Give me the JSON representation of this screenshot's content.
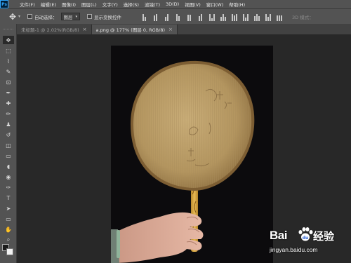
{
  "menubar": {
    "logo": "Ps",
    "items": [
      "文件(F)",
      "编辑(E)",
      "图像(I)",
      "图层(L)",
      "文字(Y)",
      "选择(S)",
      "滤镜(T)",
      "3D(D)",
      "视图(V)",
      "窗口(W)",
      "帮助(H)"
    ]
  },
  "options": {
    "auto_select_label": "自动选择：",
    "auto_select_value": "图层",
    "show_transform_label": "显示变换控件",
    "mode_3d_label": "3D 模式："
  },
  "tabs": [
    {
      "label": "未标题-1 @ 2.02%(RGB/8)",
      "active": false
    },
    {
      "label": "a.png @ 177% (图层 0, RGB/8)",
      "active": true
    }
  ],
  "icons": {
    "move": "✥",
    "marquee": "⬚",
    "lasso": "⌇",
    "quick_select": "✎",
    "crop": "⊡",
    "eyedropper": "✒",
    "healing": "✚",
    "brush": "✏",
    "stamp": "♟",
    "history_brush": "↺",
    "eraser": "◫",
    "gradient": "▭",
    "blur": "◖",
    "dodge": "◉",
    "pen": "✑",
    "type": "T",
    "path_select": "➤",
    "rectangle": "▭",
    "hand": "✋",
    "zoom": "⌕"
  },
  "colors": {
    "foreground": "#1b1b1b",
    "background": "#f2f2f2",
    "fan_fill": "#b99d6a",
    "fan_rim": "#8a6a3c",
    "handle": "#d9a33c"
  },
  "watermark": {
    "brand": "Bai",
    "paw_suffix": "经验",
    "url": "jingyan.baidu.com"
  }
}
